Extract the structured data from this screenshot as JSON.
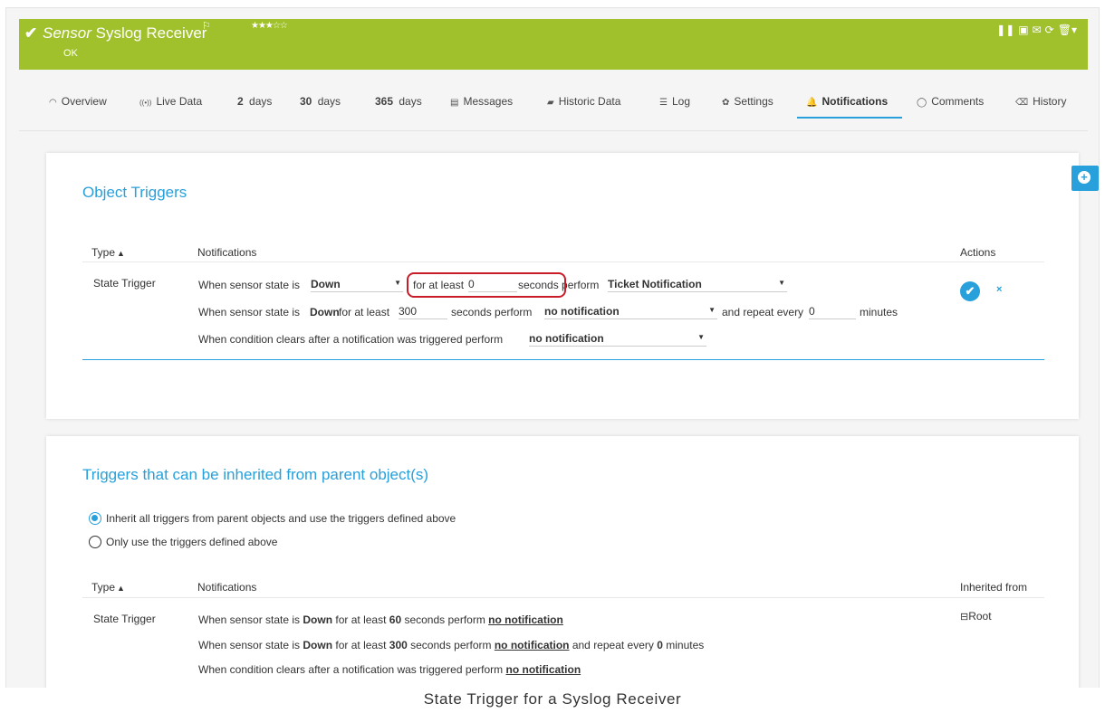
{
  "header": {
    "title_italic": "Sensor",
    "title_rest": "Syslog Receiver",
    "status": "OK",
    "stars": "★★★☆☆",
    "flag": "⚐",
    "check": "✔",
    "tools": [
      "❚❚",
      "▣",
      "✉",
      "⟳",
      "🗑▾"
    ],
    "bg_color": "#a0c12c"
  },
  "tabs": [
    {
      "icon": "◠",
      "label": "Overview"
    },
    {
      "icon": "((•))",
      "label": "Live Data"
    },
    {
      "num": "2",
      "label": "days"
    },
    {
      "num": "30",
      "label": "days"
    },
    {
      "num": "365",
      "label": "days"
    },
    {
      "icon": "▤",
      "label": "Messages"
    },
    {
      "icon": "▰",
      "label": "Historic Data"
    },
    {
      "icon": "☰",
      "label": "Log"
    },
    {
      "icon": "✿",
      "label": "Settings"
    },
    {
      "icon": "🔔",
      "label": "Notifications"
    },
    {
      "icon": "◯",
      "label": "Comments"
    },
    {
      "icon": "⌫",
      "label": "History"
    }
  ],
  "side_add": "+",
  "object_triggers": {
    "title": "Object Triggers",
    "col_type": "Type",
    "col_notifications": "Notifications",
    "col_actions": "Actions",
    "row_type": "State Trigger",
    "line1": {
      "pre": "When sensor state is",
      "state": "Down",
      "for_at_least": "for at least",
      "seconds_value": "0",
      "seconds_perform": "seconds perform",
      "notification": "Ticket Notification"
    },
    "line2": {
      "pre": "When sensor state is",
      "state": "Down",
      "for_at_least": "for at least",
      "seconds_value": "300",
      "seconds_perform": "seconds perform",
      "notification": "no notification",
      "repeat": "and repeat every",
      "repeat_value": "0",
      "minutes": "minutes"
    },
    "line3": {
      "pre": "When condition clears after a notification was triggered perform",
      "notification": "no notification"
    },
    "ok_icon": "✔",
    "cancel_icon": "×"
  },
  "inherited": {
    "title": "Triggers that can be inherited from parent object(s)",
    "radio1": "Inherit all triggers from parent objects and use the triggers defined above",
    "radio2": "Only use the triggers defined above",
    "col_type": "Type",
    "col_notifications": "Notifications",
    "col_inherited": "Inherited from",
    "row_type": "State Trigger",
    "inherited_from": "Root",
    "line1": {
      "a": "When sensor state is ",
      "b": "Down",
      "c": " for at least ",
      "d": "60",
      "e": " seconds perform ",
      "f": "no notification"
    },
    "line2": {
      "a": "When sensor state is ",
      "b": "Down",
      "c": " for at least ",
      "d": "300",
      "e": " seconds perform ",
      "f": "no notification",
      "g": " and repeat every ",
      "h": "0",
      "i": " minutes"
    },
    "line3": {
      "a": "When condition clears after a notification was triggered perform ",
      "f": "no notification"
    }
  },
  "caption": "State Trigger for a Syslog Receiver"
}
